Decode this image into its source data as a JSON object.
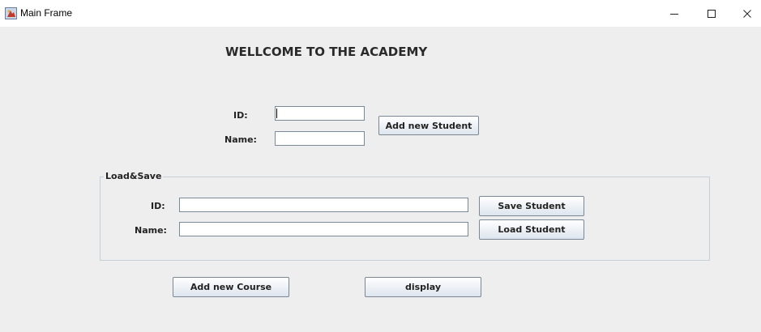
{
  "window": {
    "title": "Main Frame",
    "controls": {
      "minimize": "—",
      "maximize": "☐",
      "close": "✕"
    }
  },
  "heading": "WELLCOME TO THE ACADEMY",
  "add_student": {
    "id_label": "ID:",
    "id_value": "",
    "name_label": "Name:",
    "name_value": "",
    "button": "Add new Student"
  },
  "load_save": {
    "title": "Load&Save",
    "id_label": "ID:",
    "id_value": "",
    "name_label": "Name:",
    "name_value": "",
    "save_button": "Save Student",
    "load_button": "Load Student"
  },
  "bottom": {
    "add_course_button": "Add new Course",
    "display_button": "display"
  }
}
